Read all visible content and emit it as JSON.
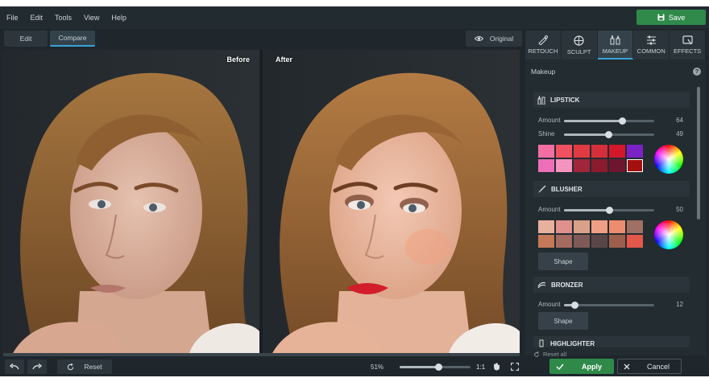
{
  "menu": [
    "File",
    "Edit",
    "Tools",
    "View",
    "Help"
  ],
  "save_label": "Save",
  "view": {
    "edit": "Edit",
    "compare": "Compare",
    "original": "Original"
  },
  "photo": {
    "before": "Before",
    "after": "After"
  },
  "bottom": {
    "reset": "Reset",
    "zoom": "51%",
    "zoom_value": 0.55,
    "ratio": "1:1",
    "apply": "Apply",
    "cancel": "Cancel"
  },
  "tabs": [
    {
      "label": "RETOUCH",
      "icon": "retouch-icon"
    },
    {
      "label": "SCULPT",
      "icon": "sculpt-icon"
    },
    {
      "label": "MAKEUP",
      "icon": "makeup-icon"
    },
    {
      "label": "COMMON",
      "icon": "sliders-icon"
    },
    {
      "label": "EFFECTS",
      "icon": "effects-icon"
    }
  ],
  "panel": {
    "title": "Makeup",
    "lipstick": {
      "title": "LIPSTICK",
      "amount_label": "Amount",
      "amount": "64",
      "amount_value": 64,
      "shine_label": "Shine",
      "shine": "49",
      "shine_value": 49,
      "colors": [
        "#f36fa3",
        "#f0505f",
        "#e23a41",
        "#d42f3a",
        "#d4172a",
        "#7b22c4",
        "#ec6fb8",
        "#f595bf",
        "#a2263b",
        "#8d1b2e",
        "#6e1630",
        "#a40f10"
      ],
      "selected_index": 11
    },
    "blusher": {
      "title": "BLUSHER",
      "amount_label": "Amount",
      "amount": "50",
      "amount_value": 50,
      "colors": [
        "#e8b19d",
        "#e0918e",
        "#d9a288",
        "#ef9f85",
        "#eb8d6e",
        "#a07064",
        "#c57957",
        "#a56a60",
        "#7e5a57",
        "#5a4648",
        "#9d5f4b",
        "#e4584a"
      ],
      "shape_label": "Shape"
    },
    "bronzer": {
      "title": "BRONZER",
      "amount_label": "Amount",
      "amount": "12",
      "amount_value": 12,
      "shape_label": "Shape"
    },
    "highlighter": {
      "title": "HIGHLIGHTER"
    },
    "reset_all": "Reset all"
  }
}
